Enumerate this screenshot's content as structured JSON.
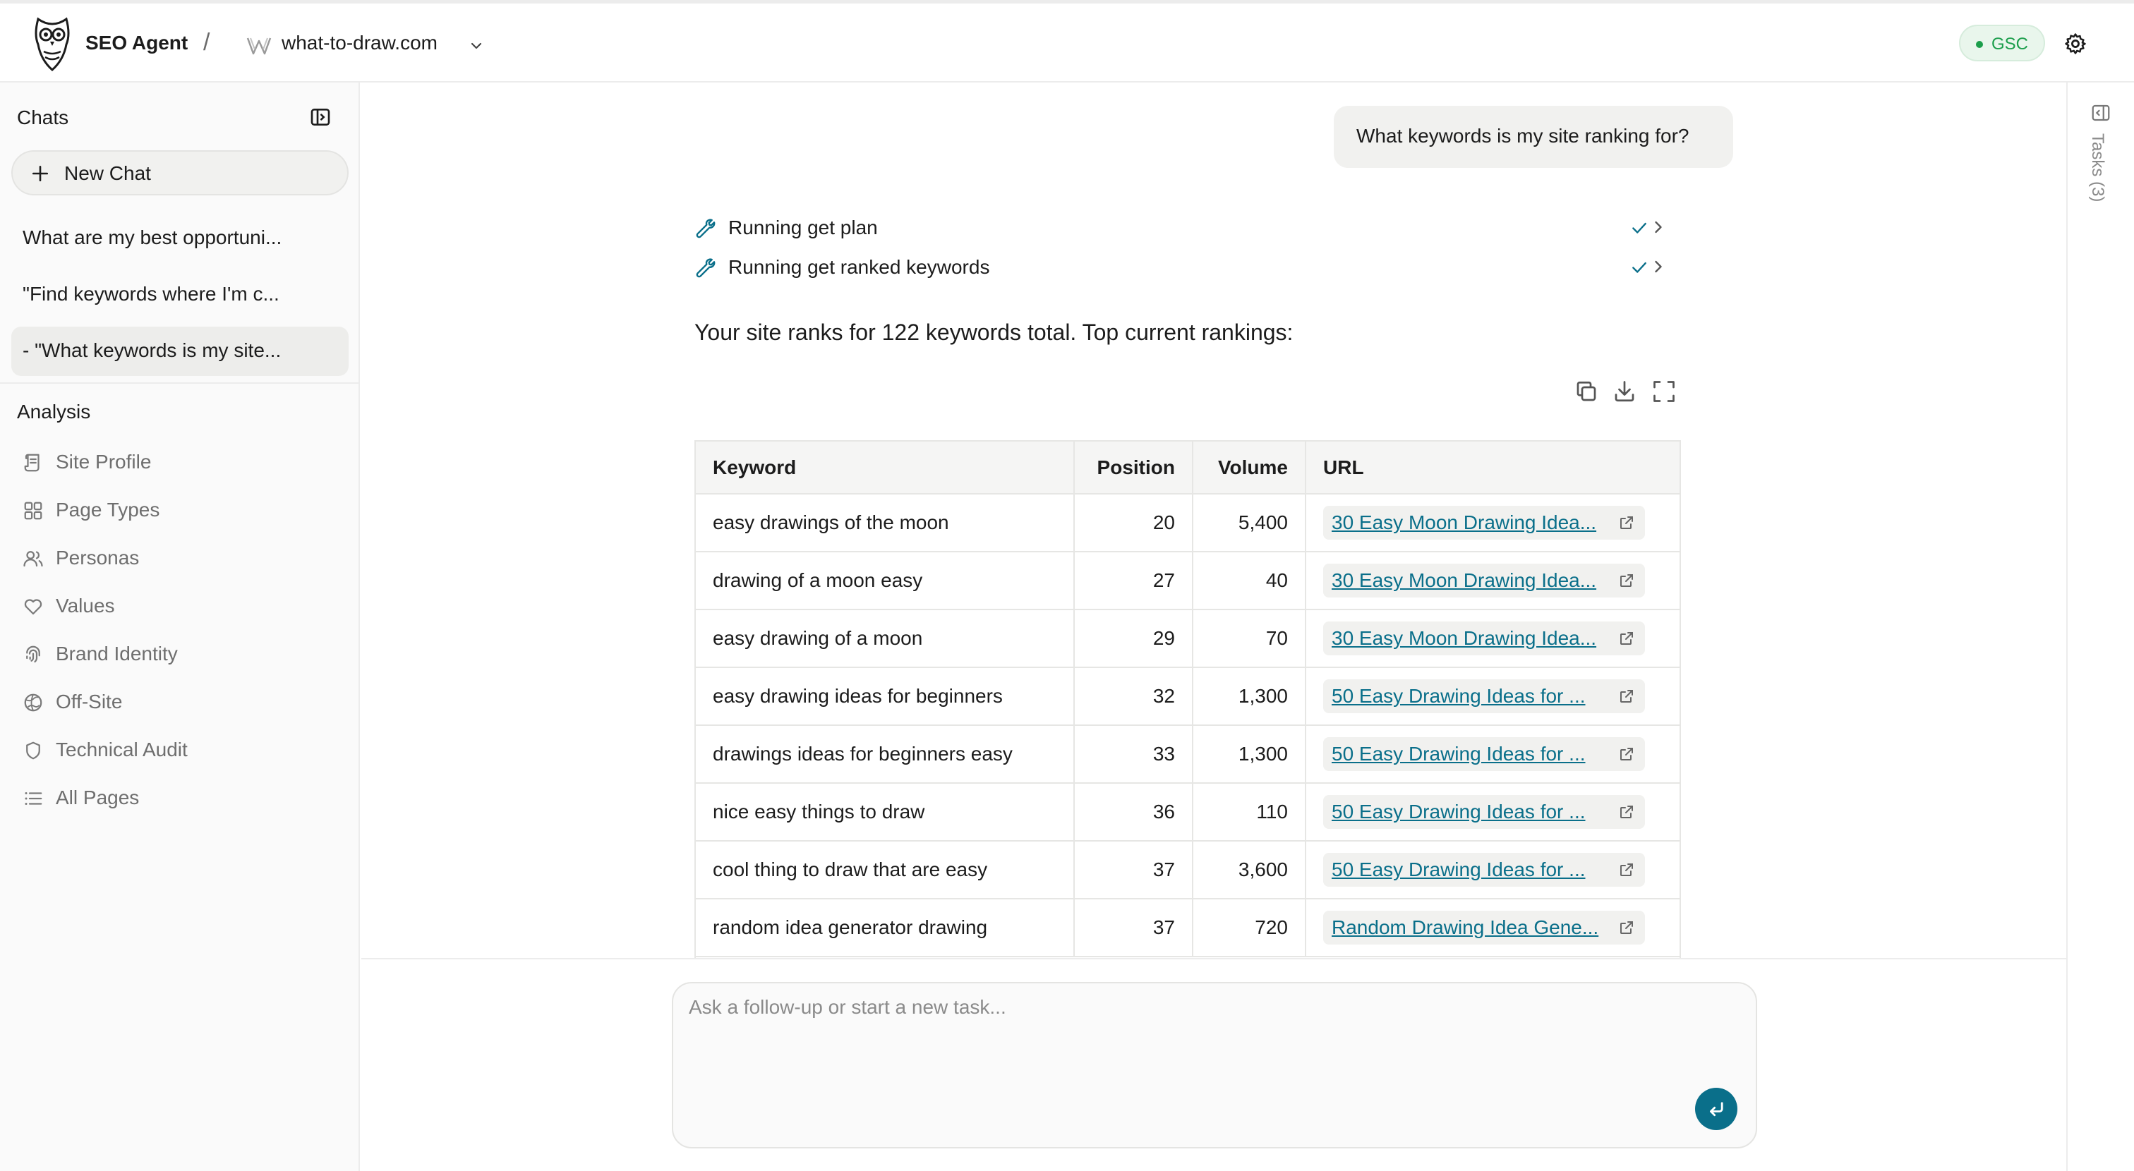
{
  "header": {
    "app_name": "SEO Agent",
    "separator": "/",
    "site_name": "what-to-draw.com",
    "gsc_label": "GSC"
  },
  "sidebar": {
    "chats_title": "Chats",
    "new_chat_label": "New Chat",
    "chats": [
      {
        "label": "What are my best opportuni..."
      },
      {
        "label": "\"Find keywords where I'm c..."
      },
      {
        "label": "- \"What keywords is my site..."
      }
    ],
    "analysis_title": "Analysis",
    "analysis_items": [
      {
        "label": "Site Profile",
        "icon": "scroll-icon"
      },
      {
        "label": "Page Types",
        "icon": "grid-icon"
      },
      {
        "label": "Personas",
        "icon": "users-icon"
      },
      {
        "label": "Values",
        "icon": "heart-icon"
      },
      {
        "label": "Brand Identity",
        "icon": "fingerprint-icon"
      },
      {
        "label": "Off-Site",
        "icon": "globe-icon"
      },
      {
        "label": "Technical Audit",
        "icon": "shield-icon"
      },
      {
        "label": "All Pages",
        "icon": "list-icon"
      }
    ]
  },
  "conversation": {
    "user_message": "What keywords is my site ranking for?",
    "tool_calls": [
      {
        "label": "Running get plan",
        "status": "done"
      },
      {
        "label": "Running get ranked keywords",
        "status": "done"
      }
    ],
    "summary": "Your site ranks for 122 keywords total. Top current rankings:"
  },
  "table": {
    "headers": {
      "keyword": "Keyword",
      "position": "Position",
      "volume": "Volume",
      "url": "URL"
    },
    "rows": [
      {
        "keyword": "easy drawings of the moon",
        "position": "20",
        "volume": "5,400",
        "url": "30 Easy Moon Drawing Idea..."
      },
      {
        "keyword": "drawing of a moon easy",
        "position": "27",
        "volume": "40",
        "url": "30 Easy Moon Drawing Idea..."
      },
      {
        "keyword": "easy drawing of a moon",
        "position": "29",
        "volume": "70",
        "url": "30 Easy Moon Drawing Idea..."
      },
      {
        "keyword": "easy drawing ideas for beginners",
        "position": "32",
        "volume": "1,300",
        "url": "50 Easy Drawing Ideas for ..."
      },
      {
        "keyword": "drawings ideas for beginners easy",
        "position": "33",
        "volume": "1,300",
        "url": "50 Easy Drawing Ideas for ..."
      },
      {
        "keyword": "nice easy things to draw",
        "position": "36",
        "volume": "110",
        "url": "50 Easy Drawing Ideas for ..."
      },
      {
        "keyword": "cool thing to draw that are easy",
        "position": "37",
        "volume": "3,600",
        "url": "50 Easy Drawing Ideas for ..."
      },
      {
        "keyword": "random idea generator drawing",
        "position": "37",
        "volume": "720",
        "url": "Random Drawing Idea Gene..."
      }
    ]
  },
  "composer": {
    "placeholder": "Ask a follow-up or start a new task..."
  },
  "right_rail": {
    "tasks_label": "Tasks (3)"
  },
  "colors": {
    "accent": "#0a6f8a",
    "gsc_green": "#1b9e4b",
    "muted_text": "#6e6e6e"
  }
}
